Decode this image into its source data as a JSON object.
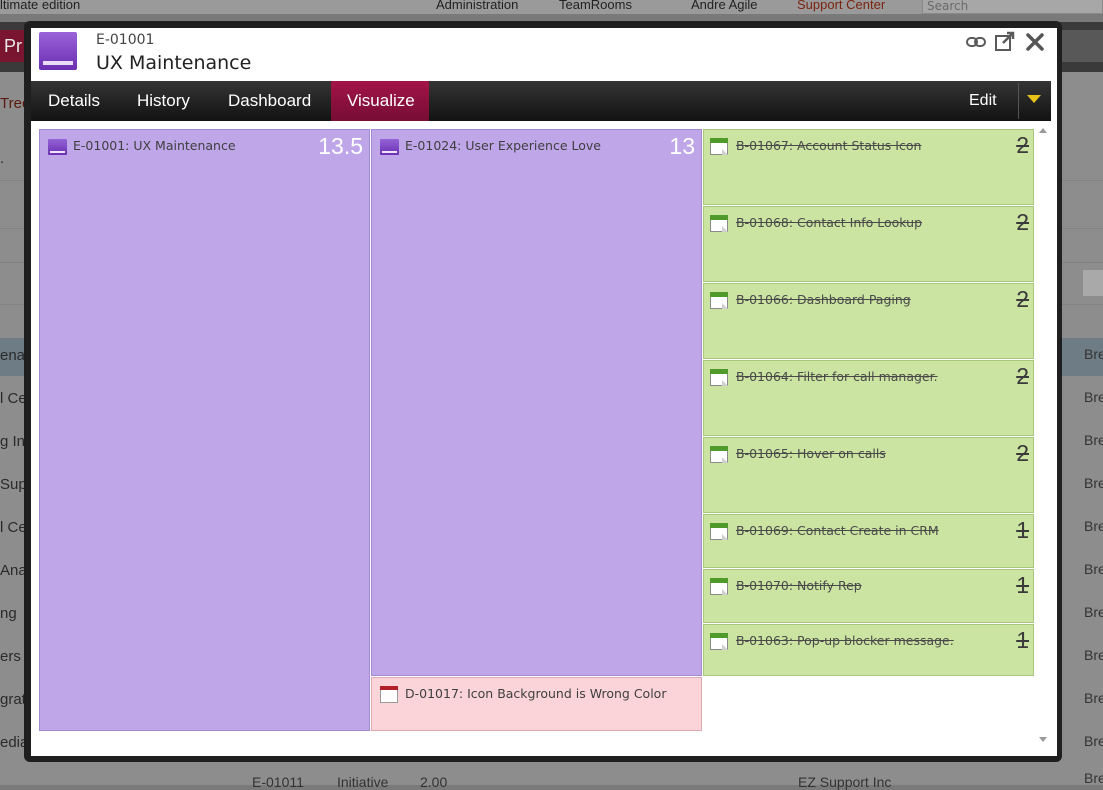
{
  "background": {
    "topbar": {
      "edition": "ltimate edition",
      "menu_administration": "Administration",
      "menu_teamrooms": "TeamRooms",
      "user": "Andre Agile",
      "support": "Support Center",
      "search_placeholder": "Search"
    },
    "left_fragments": [
      "Pr",
      "Tree",
      ".",
      "enar",
      "l Ce",
      "g In",
      "Supp",
      "l Ce",
      "Ana",
      "ng",
      "ers",
      "grat",
      "edia"
    ],
    "right_fragments": [
      "Bre",
      "Bre",
      "Bre",
      "Bre",
      "Bre",
      "Bre",
      "Bre",
      "Bre",
      "Bre",
      "Bre",
      "Bre"
    ],
    "bottom_row": {
      "id": "E-01011",
      "type": "Initiative",
      "value": "2.00",
      "owner": "EZ Support Inc"
    }
  },
  "dialog": {
    "item_id": "E-01001",
    "item_title": "UX Maintenance",
    "tools": [
      "link-icon",
      "popout-icon",
      "close-icon"
    ],
    "tabs": [
      {
        "label": "Details",
        "active": false
      },
      {
        "label": "History",
        "active": false
      },
      {
        "label": "Dashboard",
        "active": false
      },
      {
        "label": "Visualize",
        "active": true
      }
    ],
    "edit_label": "Edit"
  },
  "treemap": {
    "colors": {
      "epic": "#bea6e8",
      "story_closed": "#cce4a2",
      "defect": "#fad4d8",
      "active_tab": "#a31449"
    },
    "tiles": [
      {
        "label": "E-01001: UX Maintenance",
        "value": "13.5",
        "kind": "epic"
      },
      {
        "label": "E-01024: User Experience Love",
        "value": "13",
        "kind": "epic"
      },
      {
        "label": "D-01017: Icon Background is Wrong Color",
        "value": "",
        "kind": "defect"
      },
      {
        "label": "B-01067: Account Status Icon",
        "value": "2",
        "kind": "story",
        "closed": true
      },
      {
        "label": "B-01068: Contact Info Lookup",
        "value": "2",
        "kind": "story",
        "closed": true
      },
      {
        "label": "B-01066: Dashboard Paging",
        "value": "2",
        "kind": "story",
        "closed": true
      },
      {
        "label": "B-01064: Filter for call manager.",
        "value": "2",
        "kind": "story",
        "closed": true
      },
      {
        "label": "B-01065: Hover on calls",
        "value": "2",
        "kind": "story",
        "closed": true
      },
      {
        "label": "B-01069: Contact Create in CRM",
        "value": "1",
        "kind": "story",
        "closed": true
      },
      {
        "label": "B-01070: Notify Rep",
        "value": "1",
        "kind": "story",
        "closed": true
      },
      {
        "label": "B-01063: Pop-up blocker message.",
        "value": "1",
        "kind": "story",
        "closed": true
      }
    ]
  }
}
